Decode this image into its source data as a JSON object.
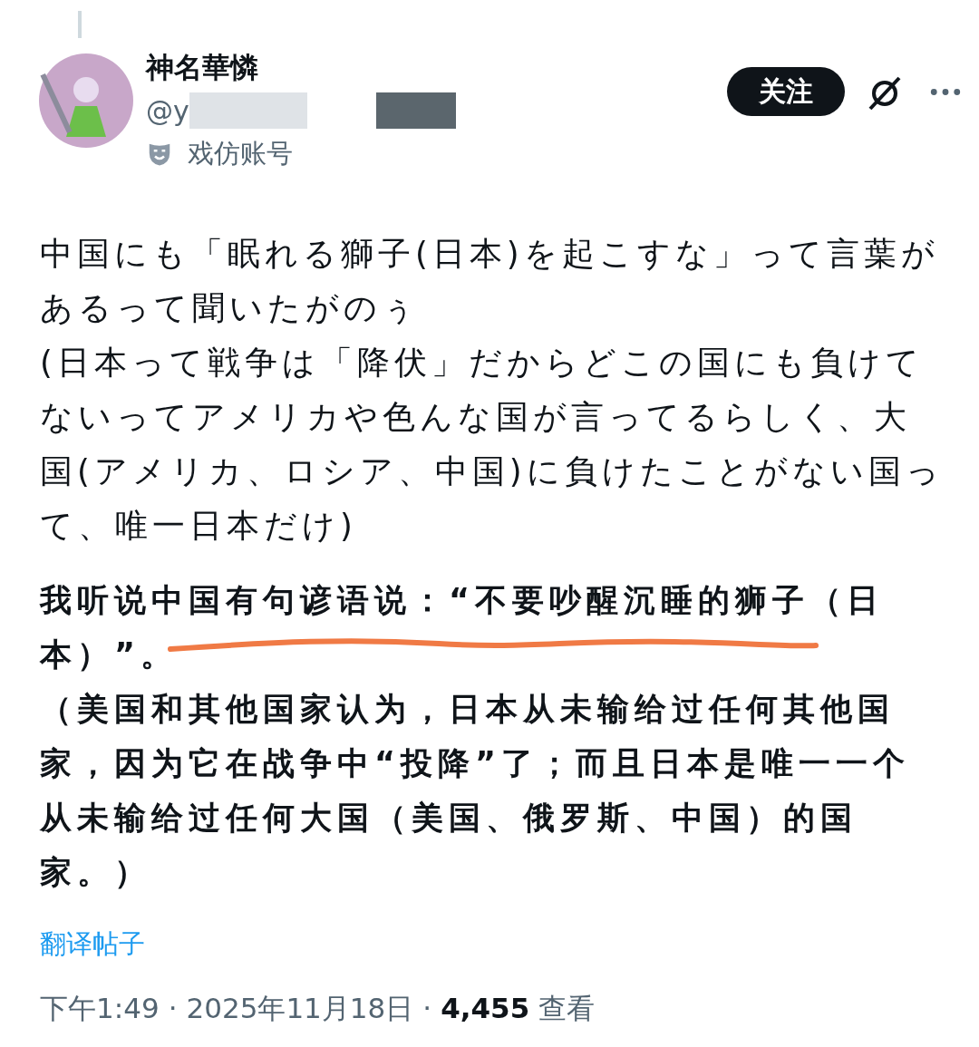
{
  "post": {
    "author": {
      "name": "神名華憐",
      "handle": "@y",
      "label": "戏仿账号"
    },
    "follow_button": "关注",
    "paragraphs": [
      {
        "kind": "plain",
        "lines": [
          "中国にも「眠れる獅子(日本)を起こすな」って言葉が",
          "あるって聞いたがのぅ",
          "(日本って戦争は「降伏」だからどこの国にも負けて",
          "ないってアメリカや色んな国が言ってるらしく、大",
          "国(アメリカ、ロシア、中国)に負けたことがない国っ",
          "て、唯一日本だけ)"
        ]
      },
      {
        "kind": "bold",
        "lines": [
          "我听说中国有句谚语说：“不要吵醒沉睡的狮子（日",
          "本）”。",
          "（美国和其他国家认为，日本从未输给过任何其他国",
          "家，因为它在战争中“投降”了；而且日本是唯一一个",
          "从未输给过任何大国（美国、俄罗斯、中国）的国",
          "家。）"
        ]
      }
    ],
    "translate_link": "翻译帖子",
    "time": "下午1:49",
    "date": "2025年11月18日",
    "separator": "·",
    "views": "4,455",
    "views_label": "查看"
  }
}
